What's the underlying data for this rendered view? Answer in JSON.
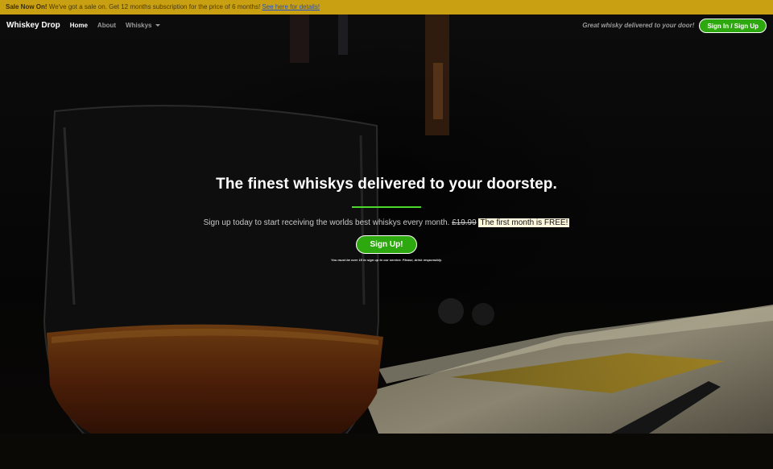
{
  "banner": {
    "title": "Sale Now On!",
    "message": "We've got a sale on. Get 12 months subscription for the price of 6 months!",
    "link": "See here for details!"
  },
  "nav": {
    "brand": "Whiskey Drop",
    "items": [
      {
        "label": "Home"
      },
      {
        "label": "About"
      },
      {
        "label": "Whiskys"
      }
    ],
    "tagline": "Great whisky delivered to your door!",
    "signin_label": "Sign In / Sign Up"
  },
  "hero": {
    "headline": "The finest whiskys delivered to your doorstep.",
    "subline": "Sign up today to start receiving the worlds best whiskys every month.",
    "old_price": "£19.99",
    "offer": "The first month is FREE!",
    "cta_label": "Sign Up!",
    "disclaimer": "You must be over 18 to sign up to our service. Please, drink responsibly."
  },
  "colors": {
    "banner": "#c9a012",
    "accent_green": "#2ea80f",
    "divider_green": "#4dd92b"
  }
}
